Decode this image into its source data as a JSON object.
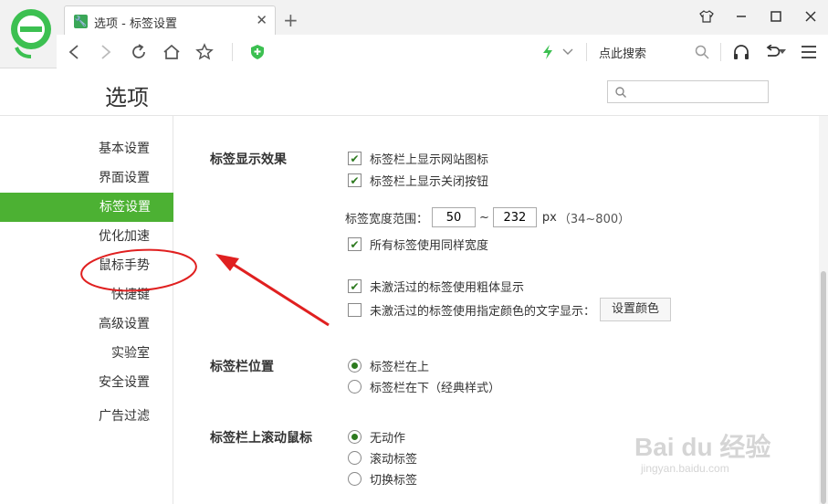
{
  "browser": {
    "tab": {
      "title": "选项 - 标签设置"
    },
    "toolbar": {
      "search_text": "点此搜索"
    }
  },
  "page": {
    "title": "选项",
    "search_placeholder": ""
  },
  "sidebar": {
    "items": [
      {
        "label": "基本设置",
        "active": false
      },
      {
        "label": "界面设置",
        "active": false
      },
      {
        "label": "标签设置",
        "active": true
      },
      {
        "label": "优化加速",
        "active": false
      },
      {
        "label": "鼠标手势",
        "active": false
      },
      {
        "label": "快捷键",
        "active": false
      },
      {
        "label": "高级设置",
        "active": false
      },
      {
        "label": "实验室",
        "active": false
      },
      {
        "label": "安全设置",
        "active": false
      },
      {
        "label": "广告过滤",
        "active": false
      }
    ]
  },
  "sections": {
    "tab_display": {
      "title": "标签显示效果",
      "show_site_icon": {
        "label": "标签栏上显示网站图标",
        "checked": true
      },
      "show_close_btn": {
        "label": "标签栏上显示关闭按钮",
        "checked": true
      },
      "width_range": {
        "label": "标签宽度范围：",
        "min": "50",
        "sep": "~",
        "max": "232",
        "unit": "px",
        "hint": "（34~800）"
      },
      "same_width": {
        "label": "所有标签使用同样宽度",
        "checked": true
      },
      "inactive_bold": {
        "label": "未激活过的标签使用粗体显示",
        "checked": true
      },
      "inactive_color": {
        "label": "未激活过的标签使用指定颜色的文字显示：",
        "checked": false
      },
      "set_color_button": "设置颜色"
    },
    "tab_position": {
      "title": "标签栏位置",
      "options": [
        {
          "label": "标签栏在上",
          "selected": true
        },
        {
          "label": "标签栏在下（经典样式）",
          "selected": false
        }
      ]
    },
    "tab_scroll": {
      "title": "标签栏上滚动鼠标",
      "options": [
        {
          "label": "无动作",
          "selected": true
        },
        {
          "label": "滚动标签",
          "selected": false
        },
        {
          "label": "切换标签",
          "selected": false
        }
      ]
    }
  },
  "watermark": {
    "main": "Bai du 经验",
    "sub": "jingyan.baidu.com"
  },
  "colors": {
    "accent": "#4cb133",
    "annotation": "#e02020"
  }
}
